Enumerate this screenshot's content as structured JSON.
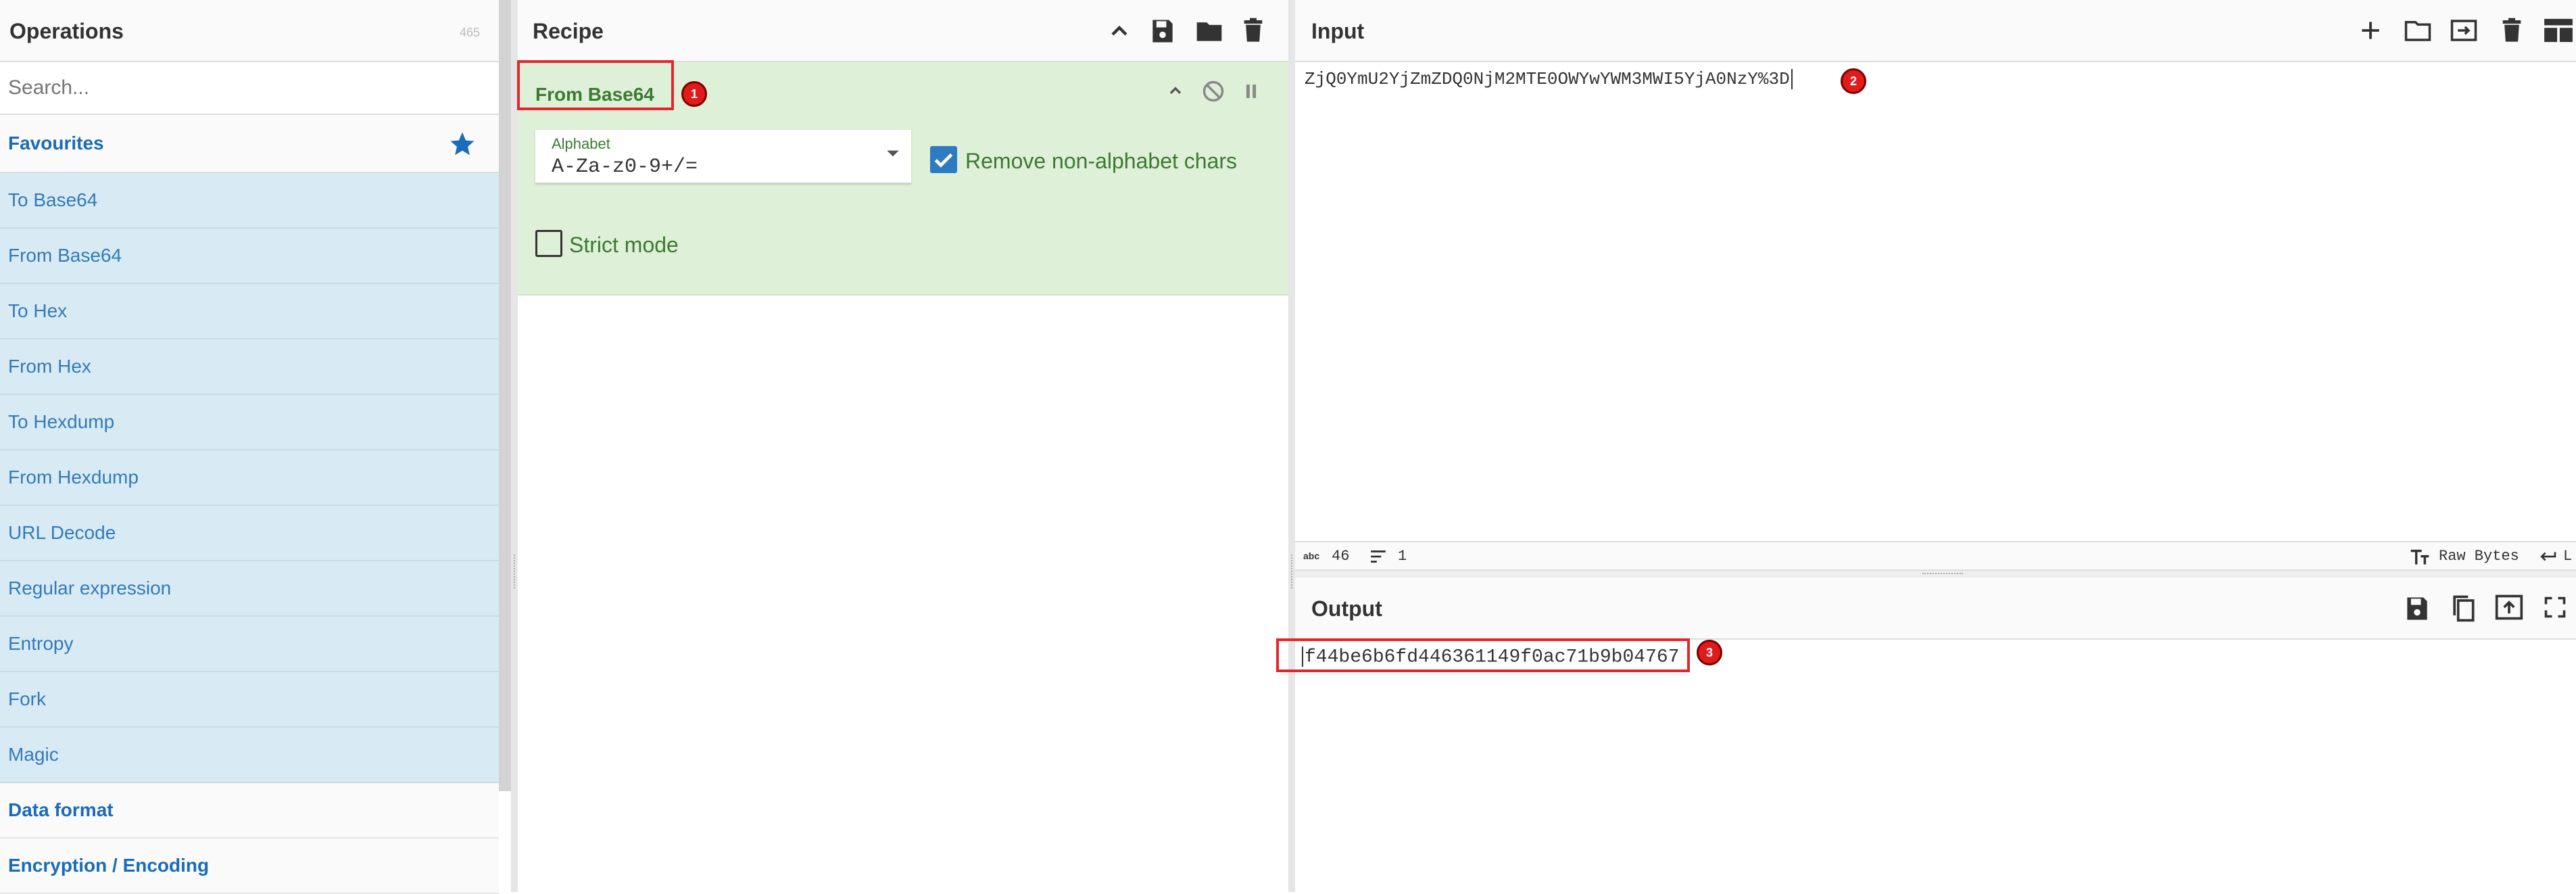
{
  "operations": {
    "title": "Operations",
    "count": "465",
    "search_placeholder": "Search...",
    "favourites_label": "Favourites",
    "items": [
      {
        "label": "To Base64"
      },
      {
        "label": "From Base64"
      },
      {
        "label": "To Hex"
      },
      {
        "label": "From Hex"
      },
      {
        "label": "To Hexdump"
      },
      {
        "label": "From Hexdump"
      },
      {
        "label": "URL Decode"
      },
      {
        "label": "Regular expression"
      },
      {
        "label": "Entropy"
      },
      {
        "label": "Fork"
      },
      {
        "label": "Magic"
      }
    ],
    "categories": [
      {
        "label": "Data format"
      },
      {
        "label": "Encryption / Encoding"
      }
    ]
  },
  "recipe": {
    "title": "Recipe",
    "operation": {
      "name": "From Base64",
      "alphabet_label": "Alphabet",
      "alphabet_value": "A-Za-z0-9+/=",
      "remove_non_alphabet_label": "Remove non-alphabet chars",
      "remove_non_alphabet_checked": true,
      "strict_mode_label": "Strict mode",
      "strict_mode_checked": false
    }
  },
  "input": {
    "title": "Input",
    "value": "ZjQ0YmU2YjZmZDQ0NjM2MTE0OWYwYWM3MWI5YjA0NzY%3D",
    "status": {
      "chars_icon_label": "abc",
      "length": "46",
      "lines": "1",
      "encoding": "Raw Bytes",
      "eol_partial": "L"
    }
  },
  "output": {
    "title": "Output",
    "value": "f44be6b6fd446361149f0ac71b9b04767"
  },
  "annotations": [
    "1",
    "2",
    "3"
  ],
  "colors": {
    "favourite_star": "#1a6bb8",
    "ops_item_bg": "#d8ebf4",
    "recipe_op_bg": "#dff0d8",
    "recipe_op_text": "#3c7a32",
    "checkbox_checked": "#2f7bc2",
    "annotation_red": "#e3262b"
  }
}
